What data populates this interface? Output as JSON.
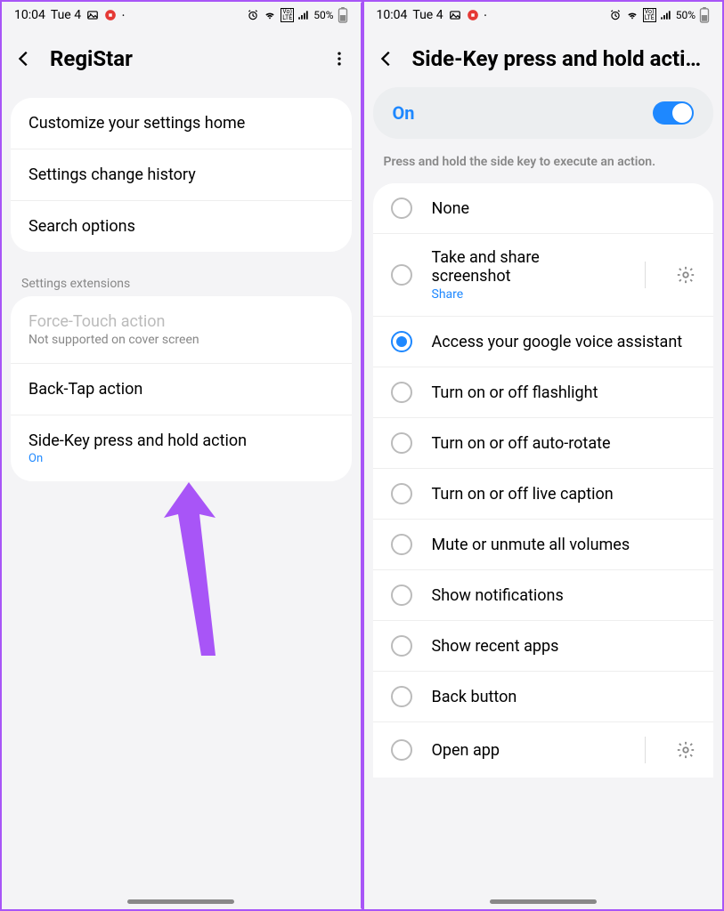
{
  "status": {
    "time": "10:04",
    "date": "Tue 4",
    "battery": "50%"
  },
  "left": {
    "title": "RegiStar",
    "rows1": [
      "Customize your settings home",
      "Settings change history",
      "Search options"
    ],
    "section_label": "Settings extensions",
    "force_touch": {
      "title": "Force-Touch action",
      "sub": "Not supported on cover screen"
    },
    "back_tap": "Back-Tap action",
    "side_key": {
      "title": "Side-Key press and hold action",
      "status": "On"
    }
  },
  "right": {
    "title": "Side-Key press and hold acti…",
    "toggle_label": "On",
    "description": "Press and hold the side key to execute an action.",
    "options": [
      {
        "label": "None",
        "checked": false,
        "gear": false
      },
      {
        "label": "Take and share screenshot",
        "sub": "Share",
        "checked": false,
        "gear": true
      },
      {
        "label": "Access your google voice assistant",
        "checked": true,
        "gear": false
      },
      {
        "label": "Turn on or off flashlight",
        "checked": false,
        "gear": false
      },
      {
        "label": "Turn on or off auto-rotate",
        "checked": false,
        "gear": false
      },
      {
        "label": "Turn on or off live caption",
        "checked": false,
        "gear": false
      },
      {
        "label": "Mute or unmute all volumes",
        "checked": false,
        "gear": false
      },
      {
        "label": "Show notifications",
        "checked": false,
        "gear": false
      },
      {
        "label": "Show recent apps",
        "checked": false,
        "gear": false
      },
      {
        "label": "Back button",
        "checked": false,
        "gear": false
      },
      {
        "label": "Open app",
        "checked": false,
        "gear": true
      }
    ]
  }
}
